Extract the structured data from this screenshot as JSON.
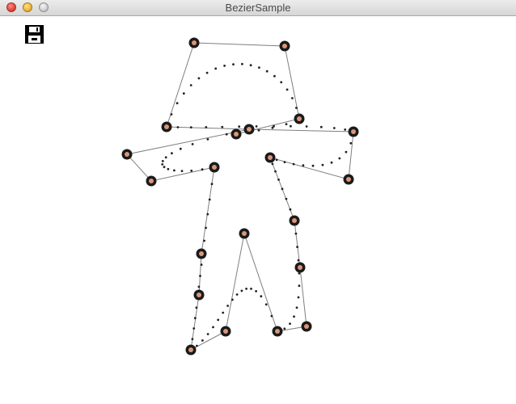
{
  "window": {
    "title": "BezierSample"
  },
  "toolbar": {
    "save_icon": "floppy-disk-save-icon"
  },
  "colors": {
    "background": "#ffffff",
    "handle_ring": "#1a1a1a",
    "handle_center": "#d9967a",
    "control_line": "#7f7f7f",
    "curve_dots": "#222222"
  }
}
